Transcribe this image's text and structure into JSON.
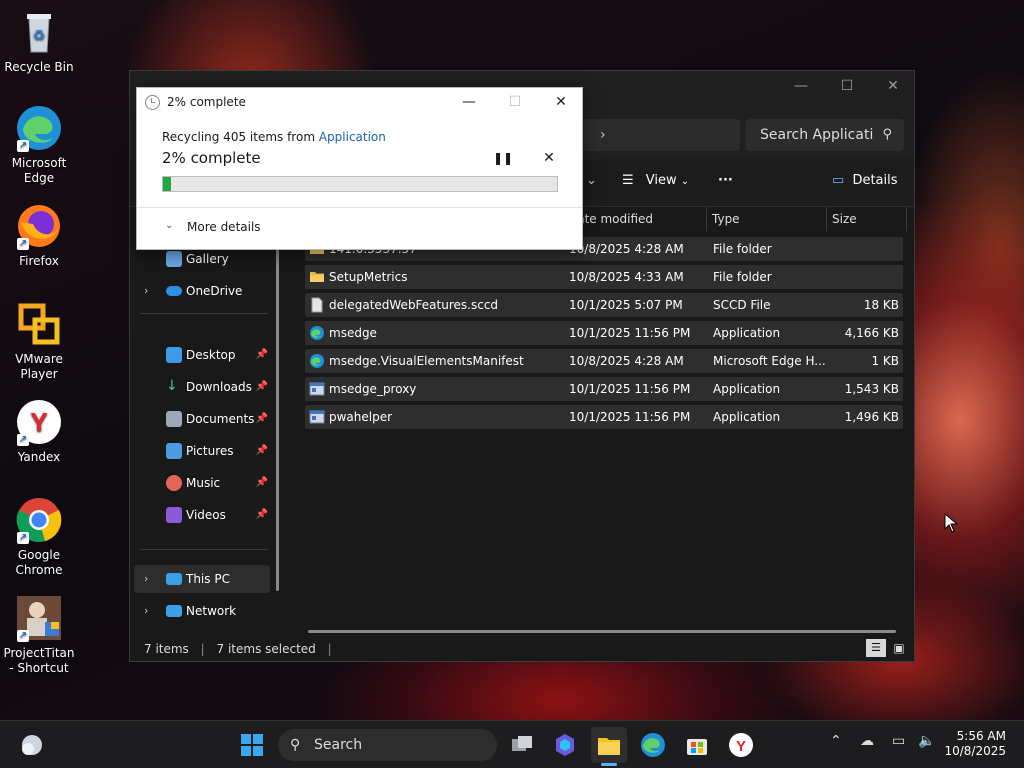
{
  "desktop": {
    "icons": [
      {
        "label": "Recycle Bin",
        "icon": "recycle-bin-icon"
      },
      {
        "label": "Microsoft Edge",
        "icon": "edge-icon"
      },
      {
        "label": "Firefox",
        "icon": "firefox-icon"
      },
      {
        "label": "VMware Player",
        "icon": "vmware-icon"
      },
      {
        "label": "Yandex",
        "icon": "yandex-icon"
      },
      {
        "label": "Google Chrome",
        "icon": "chrome-icon"
      },
      {
        "label": "ProjectTitan - Shortcut",
        "icon": "projecttitan-icon"
      }
    ]
  },
  "explorer": {
    "address_chevron": "›",
    "search_placeholder": "Search Applicati",
    "toolbar": {
      "view_label": "View",
      "more_label": "···",
      "details_label": "Details"
    },
    "columns": {
      "date": "Date modified",
      "type": "Type",
      "size": "Size"
    },
    "nav": [
      {
        "label": "Gallery"
      },
      {
        "label": "OneDrive"
      },
      {
        "label": "Desktop"
      },
      {
        "label": "Downloads"
      },
      {
        "label": "Documents"
      },
      {
        "label": "Pictures"
      },
      {
        "label": "Music"
      },
      {
        "label": "Videos"
      },
      {
        "label": "This PC"
      },
      {
        "label": "Network"
      }
    ],
    "files": [
      {
        "name": "141.0.3537.57",
        "date": "10/8/2025 4:28 AM",
        "type": "File folder",
        "size": ""
      },
      {
        "name": "SetupMetrics",
        "date": "10/8/2025 4:33 AM",
        "type": "File folder",
        "size": ""
      },
      {
        "name": "delegatedWebFeatures.sccd",
        "date": "10/1/2025 5:07 PM",
        "type": "SCCD File",
        "size": "18 KB"
      },
      {
        "name": "msedge",
        "date": "10/1/2025 11:56 PM",
        "type": "Application",
        "size": "4,166 KB"
      },
      {
        "name": "msedge.VisualElementsManifest",
        "date": "10/8/2025 4:28 AM",
        "type": "Microsoft Edge H...",
        "size": "1 KB"
      },
      {
        "name": "msedge_proxy",
        "date": "10/1/2025 11:56 PM",
        "type": "Application",
        "size": "1,543 KB"
      },
      {
        "name": "pwahelper",
        "date": "10/1/2025 11:56 PM",
        "type": "Application",
        "size": "1,496 KB"
      }
    ],
    "status": {
      "items": "7 items",
      "selected": "7 items selected"
    }
  },
  "dialog": {
    "title": "2% complete",
    "line1_prefix": "Recycling 405 items from ",
    "line1_link": "Application",
    "line2": "2% complete",
    "progress": 0.02,
    "more_details": "More details"
  },
  "taskbar": {
    "search_label": "Search",
    "time": "5:56 AM",
    "date": "10/8/2025"
  }
}
